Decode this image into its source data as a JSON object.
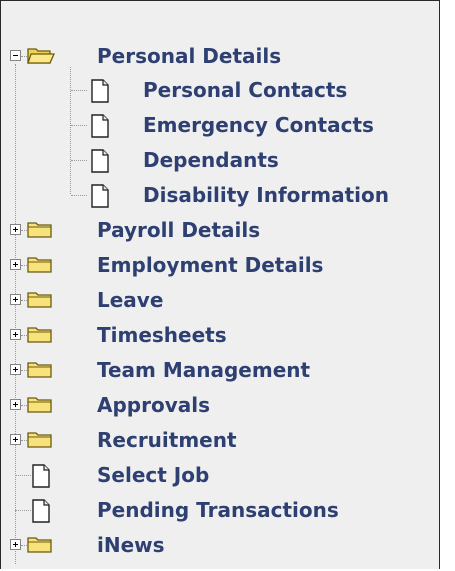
{
  "tree": {
    "items": [
      {
        "label": "Personal Details",
        "type": "folder",
        "expanded": true,
        "icon": "open-folder-icon"
      },
      {
        "label": "Personal Contacts",
        "type": "page",
        "icon": "document-icon"
      },
      {
        "label": "Emergency Contacts",
        "type": "page",
        "icon": "document-icon"
      },
      {
        "label": "Dependants",
        "type": "page",
        "icon": "document-icon"
      },
      {
        "label": "Disability Information",
        "type": "page",
        "icon": "document-icon"
      },
      {
        "label": "Payroll Details",
        "type": "folder",
        "expanded": false,
        "icon": "folder-icon"
      },
      {
        "label": "Employment Details",
        "type": "folder",
        "expanded": false,
        "icon": "folder-icon"
      },
      {
        "label": "Leave",
        "type": "folder",
        "expanded": false,
        "icon": "folder-icon"
      },
      {
        "label": "Timesheets",
        "type": "folder",
        "expanded": false,
        "icon": "folder-icon"
      },
      {
        "label": "Team Management",
        "type": "folder",
        "expanded": false,
        "icon": "folder-icon"
      },
      {
        "label": "Approvals",
        "type": "folder",
        "expanded": false,
        "icon": "folder-icon"
      },
      {
        "label": "Recruitment",
        "type": "folder",
        "expanded": false,
        "icon": "folder-icon"
      },
      {
        "label": "Select Job",
        "type": "page",
        "icon": "document-icon"
      },
      {
        "label": "Pending Transactions",
        "type": "page",
        "icon": "document-icon"
      },
      {
        "label": "iNews",
        "type": "folder",
        "expanded": false,
        "icon": "folder-icon"
      }
    ]
  },
  "colors": {
    "link": "#2e3f72",
    "panel_bg": "#efefef",
    "folder_fill": "#f7e27b",
    "folder_edge": "#8a7a1e"
  }
}
